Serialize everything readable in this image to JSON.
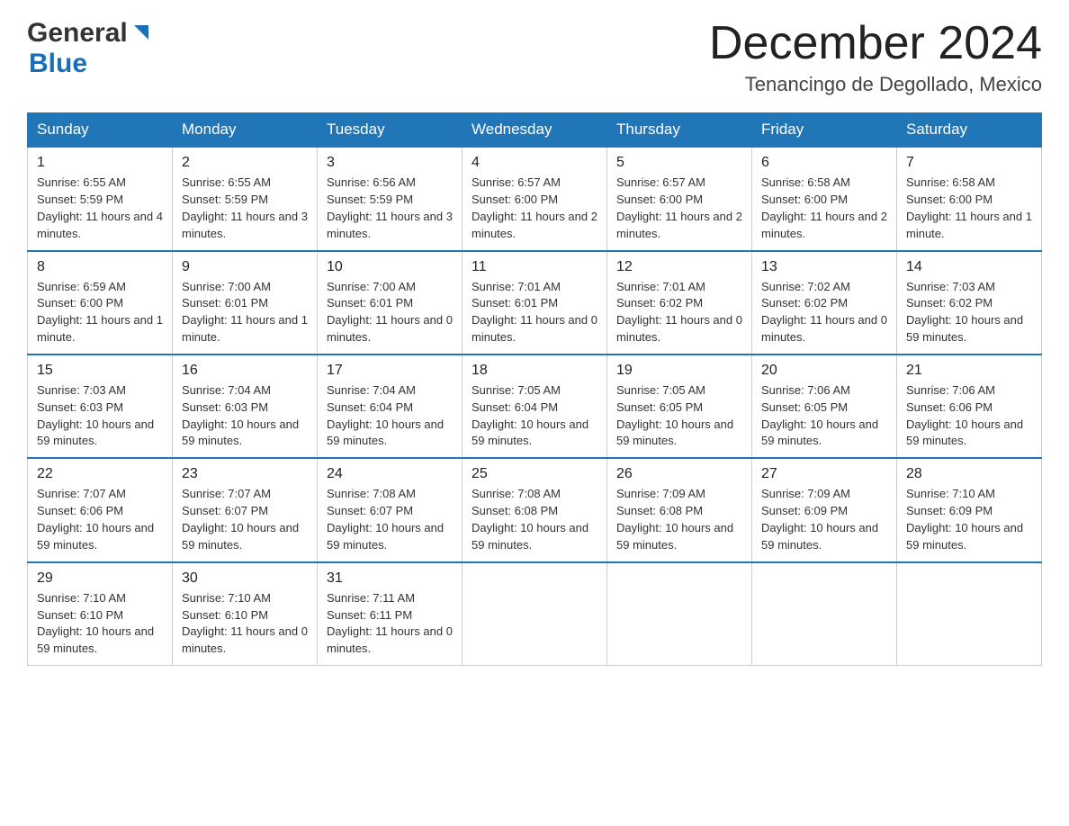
{
  "header": {
    "logo_general": "General",
    "logo_blue": "Blue",
    "month_title": "December 2024",
    "location": "Tenancingo de Degollado, Mexico"
  },
  "weekdays": [
    "Sunday",
    "Monday",
    "Tuesday",
    "Wednesday",
    "Thursday",
    "Friday",
    "Saturday"
  ],
  "weeks": [
    [
      {
        "day": "1",
        "sunrise": "6:55 AM",
        "sunset": "5:59 PM",
        "daylight": "11 hours and 4 minutes."
      },
      {
        "day": "2",
        "sunrise": "6:55 AM",
        "sunset": "5:59 PM",
        "daylight": "11 hours and 3 minutes."
      },
      {
        "day": "3",
        "sunrise": "6:56 AM",
        "sunset": "5:59 PM",
        "daylight": "11 hours and 3 minutes."
      },
      {
        "day": "4",
        "sunrise": "6:57 AM",
        "sunset": "6:00 PM",
        "daylight": "11 hours and 2 minutes."
      },
      {
        "day": "5",
        "sunrise": "6:57 AM",
        "sunset": "6:00 PM",
        "daylight": "11 hours and 2 minutes."
      },
      {
        "day": "6",
        "sunrise": "6:58 AM",
        "sunset": "6:00 PM",
        "daylight": "11 hours and 2 minutes."
      },
      {
        "day": "7",
        "sunrise": "6:58 AM",
        "sunset": "6:00 PM",
        "daylight": "11 hours and 1 minute."
      }
    ],
    [
      {
        "day": "8",
        "sunrise": "6:59 AM",
        "sunset": "6:00 PM",
        "daylight": "11 hours and 1 minute."
      },
      {
        "day": "9",
        "sunrise": "7:00 AM",
        "sunset": "6:01 PM",
        "daylight": "11 hours and 1 minute."
      },
      {
        "day": "10",
        "sunrise": "7:00 AM",
        "sunset": "6:01 PM",
        "daylight": "11 hours and 0 minutes."
      },
      {
        "day": "11",
        "sunrise": "7:01 AM",
        "sunset": "6:01 PM",
        "daylight": "11 hours and 0 minutes."
      },
      {
        "day": "12",
        "sunrise": "7:01 AM",
        "sunset": "6:02 PM",
        "daylight": "11 hours and 0 minutes."
      },
      {
        "day": "13",
        "sunrise": "7:02 AM",
        "sunset": "6:02 PM",
        "daylight": "11 hours and 0 minutes."
      },
      {
        "day": "14",
        "sunrise": "7:03 AM",
        "sunset": "6:02 PM",
        "daylight": "10 hours and 59 minutes."
      }
    ],
    [
      {
        "day": "15",
        "sunrise": "7:03 AM",
        "sunset": "6:03 PM",
        "daylight": "10 hours and 59 minutes."
      },
      {
        "day": "16",
        "sunrise": "7:04 AM",
        "sunset": "6:03 PM",
        "daylight": "10 hours and 59 minutes."
      },
      {
        "day": "17",
        "sunrise": "7:04 AM",
        "sunset": "6:04 PM",
        "daylight": "10 hours and 59 minutes."
      },
      {
        "day": "18",
        "sunrise": "7:05 AM",
        "sunset": "6:04 PM",
        "daylight": "10 hours and 59 minutes."
      },
      {
        "day": "19",
        "sunrise": "7:05 AM",
        "sunset": "6:05 PM",
        "daylight": "10 hours and 59 minutes."
      },
      {
        "day": "20",
        "sunrise": "7:06 AM",
        "sunset": "6:05 PM",
        "daylight": "10 hours and 59 minutes."
      },
      {
        "day": "21",
        "sunrise": "7:06 AM",
        "sunset": "6:06 PM",
        "daylight": "10 hours and 59 minutes."
      }
    ],
    [
      {
        "day": "22",
        "sunrise": "7:07 AM",
        "sunset": "6:06 PM",
        "daylight": "10 hours and 59 minutes."
      },
      {
        "day": "23",
        "sunrise": "7:07 AM",
        "sunset": "6:07 PM",
        "daylight": "10 hours and 59 minutes."
      },
      {
        "day": "24",
        "sunrise": "7:08 AM",
        "sunset": "6:07 PM",
        "daylight": "10 hours and 59 minutes."
      },
      {
        "day": "25",
        "sunrise": "7:08 AM",
        "sunset": "6:08 PM",
        "daylight": "10 hours and 59 minutes."
      },
      {
        "day": "26",
        "sunrise": "7:09 AM",
        "sunset": "6:08 PM",
        "daylight": "10 hours and 59 minutes."
      },
      {
        "day": "27",
        "sunrise": "7:09 AM",
        "sunset": "6:09 PM",
        "daylight": "10 hours and 59 minutes."
      },
      {
        "day": "28",
        "sunrise": "7:10 AM",
        "sunset": "6:09 PM",
        "daylight": "10 hours and 59 minutes."
      }
    ],
    [
      {
        "day": "29",
        "sunrise": "7:10 AM",
        "sunset": "6:10 PM",
        "daylight": "10 hours and 59 minutes."
      },
      {
        "day": "30",
        "sunrise": "7:10 AM",
        "sunset": "6:10 PM",
        "daylight": "11 hours and 0 minutes."
      },
      {
        "day": "31",
        "sunrise": "7:11 AM",
        "sunset": "6:11 PM",
        "daylight": "11 hours and 0 minutes."
      },
      null,
      null,
      null,
      null
    ]
  ],
  "labels": {
    "sunrise": "Sunrise:",
    "sunset": "Sunset:",
    "daylight": "Daylight:"
  }
}
